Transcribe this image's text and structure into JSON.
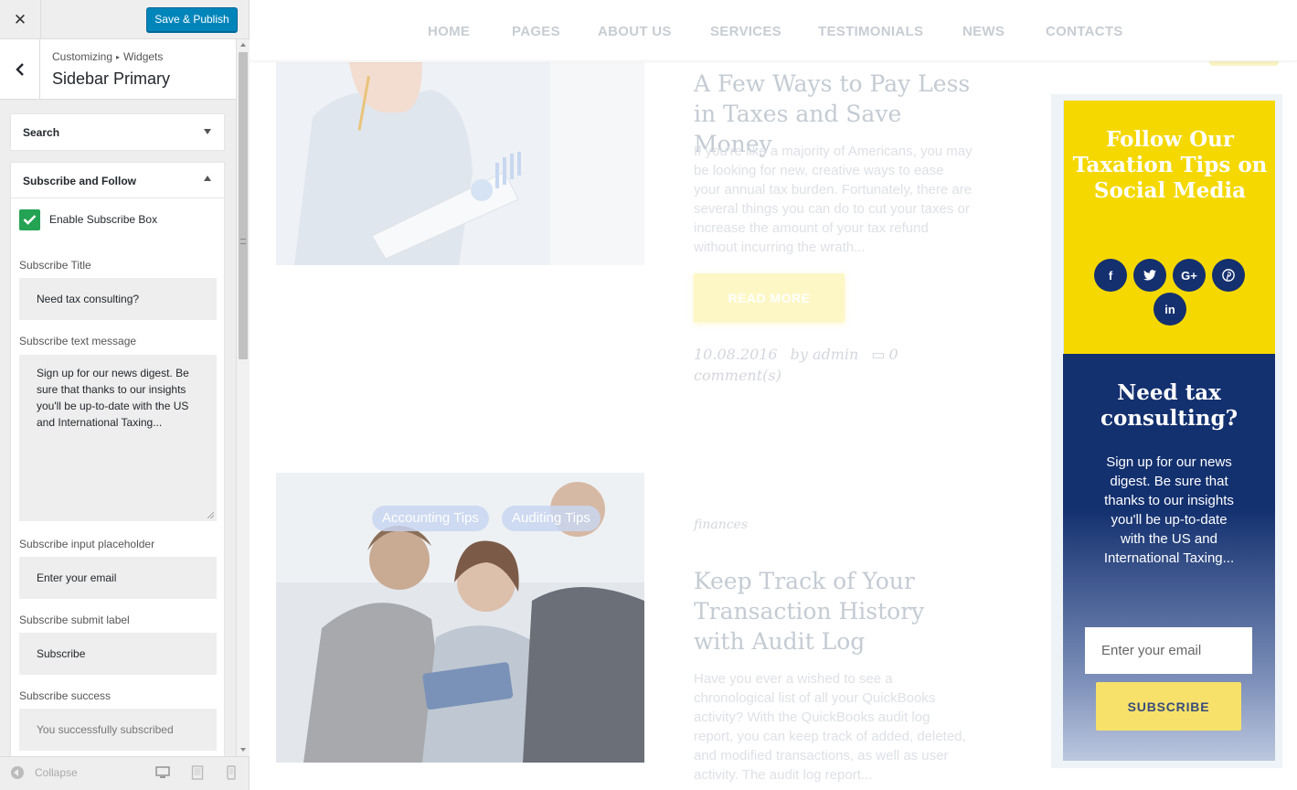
{
  "customizer": {
    "close_label": "✕",
    "save_label": "Save & Publish",
    "breadcrumb": [
      "Customizing",
      "Widgets"
    ],
    "panel_title": "Sidebar Primary",
    "widgets": [
      {
        "title": "Search",
        "expanded": false
      },
      {
        "title": "Subscribe and Follow",
        "expanded": true
      }
    ],
    "subscribe": {
      "enable_label": "Enable Subscribe Box",
      "enabled": true,
      "title_label": "Subscribe Title",
      "title_value": "Need tax consulting?",
      "text_label": "Subscribe text message",
      "text_value": "Sign up for our news digest. Be sure that thanks to our insights you'll be up-to-date with the US and International Taxing...",
      "placeholder_label": "Subscribe input placeholder",
      "placeholder_value": "Enter your email",
      "submit_label": "Subscribe submit label",
      "submit_value": "Subscribe",
      "success_label": "Subscribe success",
      "success_value": "You successfully subscribed"
    },
    "footer": {
      "collapse_label": "Collapse",
      "devices": [
        "desktop-icon",
        "tablet-icon",
        "mobile-icon"
      ]
    }
  },
  "preview": {
    "nav": [
      "HOME",
      "PAGES",
      "ABOUT US",
      "SERVICES",
      "TESTIMONIALS",
      "NEWS",
      "CONTACTS"
    ],
    "posts": [
      {
        "title": "A Few Ways to Pay Less in Taxes and Save Money",
        "excerpt": "If you're like a majority of Americans, you may be looking for new, creative ways to ease your annual tax burden. Fortunately, there are several things you can do to cut your taxes or increase the amount of your tax refund without incurring the wrath...",
        "read_more": "READ MORE",
        "date": "10.08.2016",
        "author": "by admin",
        "comments": "0 comment(s)"
      },
      {
        "tags": [
          "Accounting Tips",
          "Auditing Tips"
        ],
        "category": "finances",
        "title": "Keep Track of Your Transaction History with Audit Log",
        "excerpt": "Have you ever a wished to see a chronological list of all your QuickBooks activity? With the QuickBooks audit log report, you can keep track of added, deleted, and modified transactions, as well as user activity. The audit log report..."
      }
    ],
    "follow": {
      "title": "Follow Our Taxation Tips on Social Media",
      "socials": [
        "f",
        "t",
        "G+",
        "p",
        "in"
      ],
      "icon_names": [
        "facebook-icon",
        "twitter-icon",
        "google-plus-icon",
        "pinterest-icon",
        "linkedin-icon"
      ]
    },
    "subscribe_box": {
      "title": "Need tax consulting?",
      "text": "Sign up for our news digest. Be sure that thanks to our insights you'll be up-to-date with the US and International Taxing...",
      "placeholder": "Enter your email",
      "button": "SUBSCRIBE"
    },
    "colors": {
      "accent_yellow": "#f5d800",
      "accent_navy": "#13306f",
      "publish_blue": "#0085ba",
      "checkbox_green": "#25a354"
    }
  }
}
